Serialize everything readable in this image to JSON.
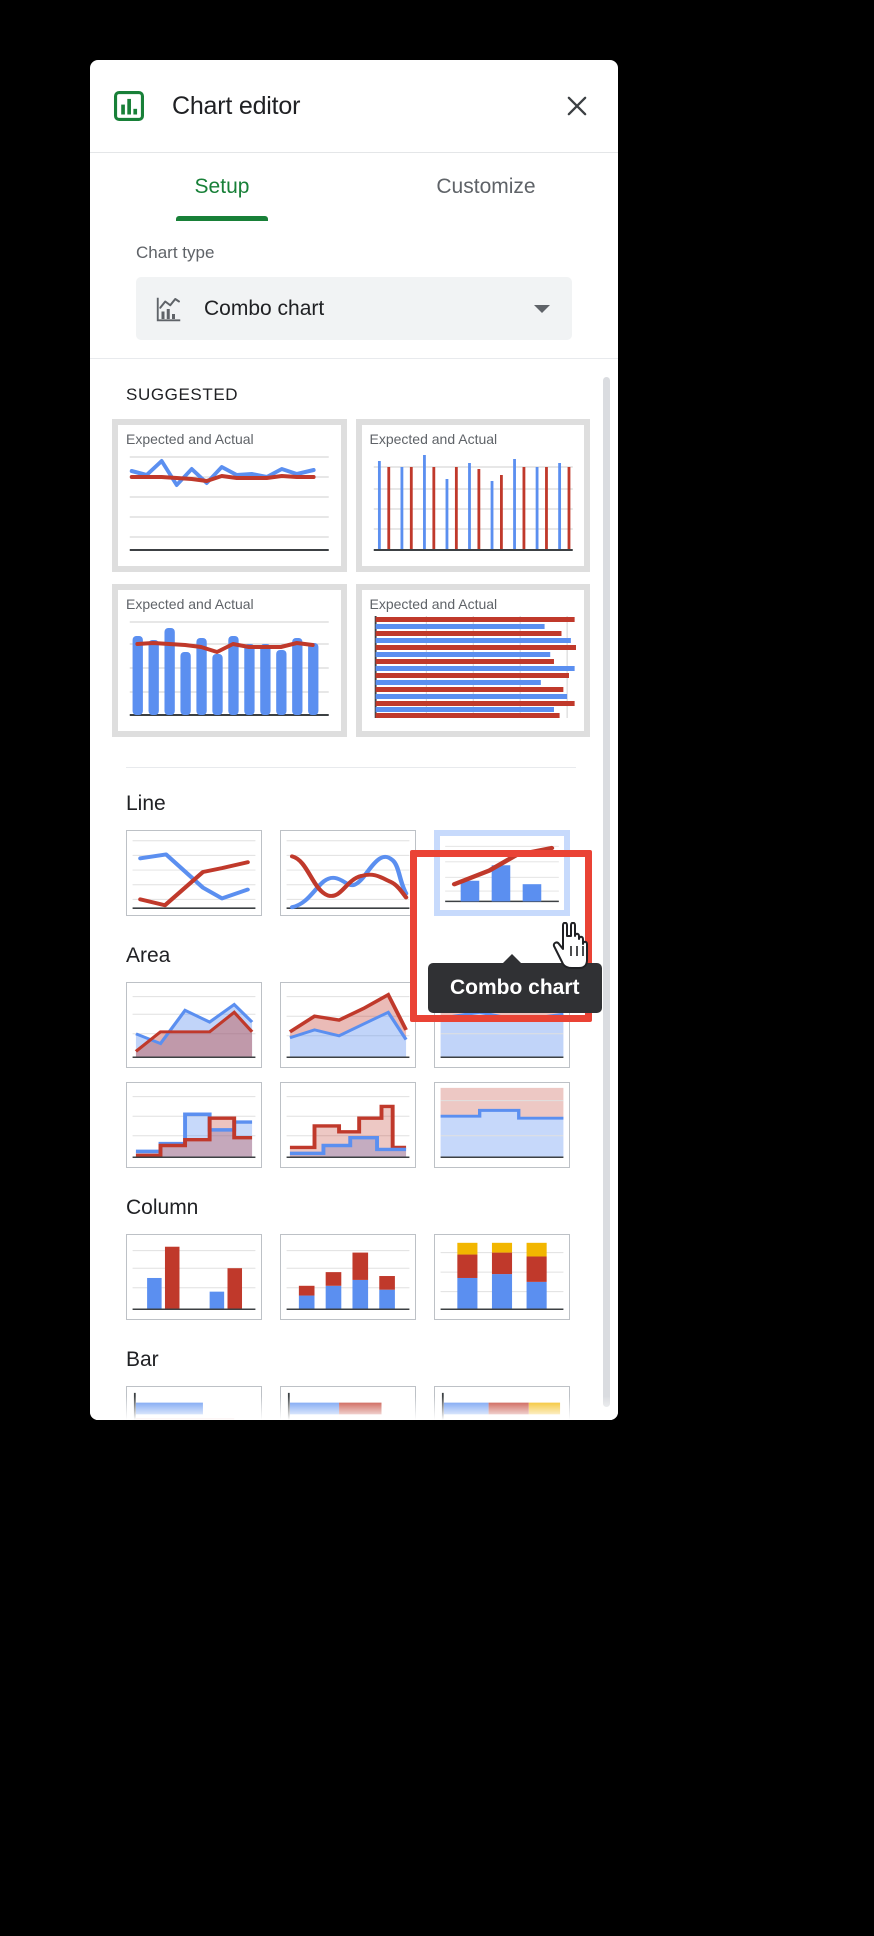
{
  "dialog": {
    "title": "Chart editor",
    "app_icon": "bar-chart-icon",
    "close_icon": "close-icon",
    "accent_green": "#188038",
    "highlight_red": "#ea4335",
    "tooltip_bg": "#303134",
    "series_blue": "#5b8ff0",
    "series_red": "#c0392b"
  },
  "tabs": [
    {
      "label": "Setup",
      "active": true
    },
    {
      "label": "Customize",
      "active": false
    }
  ],
  "chart_type": {
    "label": "Chart type",
    "selected": "Combo chart",
    "icon": "combo-chart-icon",
    "caret": "chevron-down-icon"
  },
  "suggested": {
    "caption": "SUGGESTED",
    "cards": [
      {
        "title": "Expected and Actual",
        "kind": "line"
      },
      {
        "title": "Expected and Actual",
        "kind": "thin-column"
      },
      {
        "title": "Expected and Actual",
        "kind": "column-line"
      },
      {
        "title": "Expected and Actual",
        "kind": "bar"
      }
    ]
  },
  "sections": [
    {
      "title": "Line",
      "items": [
        {
          "kind": "line-cross",
          "name": "line-chart"
        },
        {
          "kind": "line-smooth",
          "name": "smooth-line-chart"
        },
        {
          "kind": "combo",
          "name": "combo-chart",
          "selected": true,
          "tooltip": "Combo chart"
        }
      ]
    },
    {
      "title": "Area",
      "items": [
        {
          "kind": "area-overlap",
          "name": "area-chart"
        },
        {
          "kind": "area-stacked",
          "name": "stacked-area-chart"
        },
        {
          "kind": "area-100",
          "name": "100-stacked-area-chart"
        },
        {
          "kind": "step-overlap",
          "name": "stepped-area-chart"
        },
        {
          "kind": "step-stacked",
          "name": "stacked-stepped-area-chart"
        },
        {
          "kind": "step-100",
          "name": "100-stacked-stepped-area-chart"
        }
      ]
    },
    {
      "title": "Column",
      "items": [
        {
          "kind": "col-grouped",
          "name": "column-chart"
        },
        {
          "kind": "col-stacked",
          "name": "stacked-column-chart"
        },
        {
          "kind": "col-100",
          "name": "100-stacked-column-chart"
        }
      ]
    },
    {
      "title": "Bar",
      "items": [
        {
          "kind": "bar-grouped",
          "name": "bar-chart"
        },
        {
          "kind": "bar-stacked",
          "name": "stacked-bar-chart"
        },
        {
          "kind": "bar-100",
          "name": "100-stacked-bar-chart"
        }
      ]
    }
  ],
  "tooltip": {
    "text": "Combo chart"
  },
  "cursor": {
    "icon": "pointing-hand-cursor"
  },
  "chart_data": {
    "type": "line",
    "title": "Expected and Actual",
    "series": [
      {
        "name": "Expected",
        "color": "#5b8ff0",
        "values": [
          62,
          58,
          78,
          44,
          66,
          42,
          68,
          58,
          56,
          54,
          66,
          58,
          62
        ]
      },
      {
        "name": "Actual",
        "color": "#c0392b",
        "values": [
          56,
          56,
          55,
          55,
          52,
          50,
          57,
          54,
          54,
          55,
          57,
          55,
          56
        ]
      }
    ],
    "grid": true,
    "ylim": [
      0,
      100
    ]
  }
}
